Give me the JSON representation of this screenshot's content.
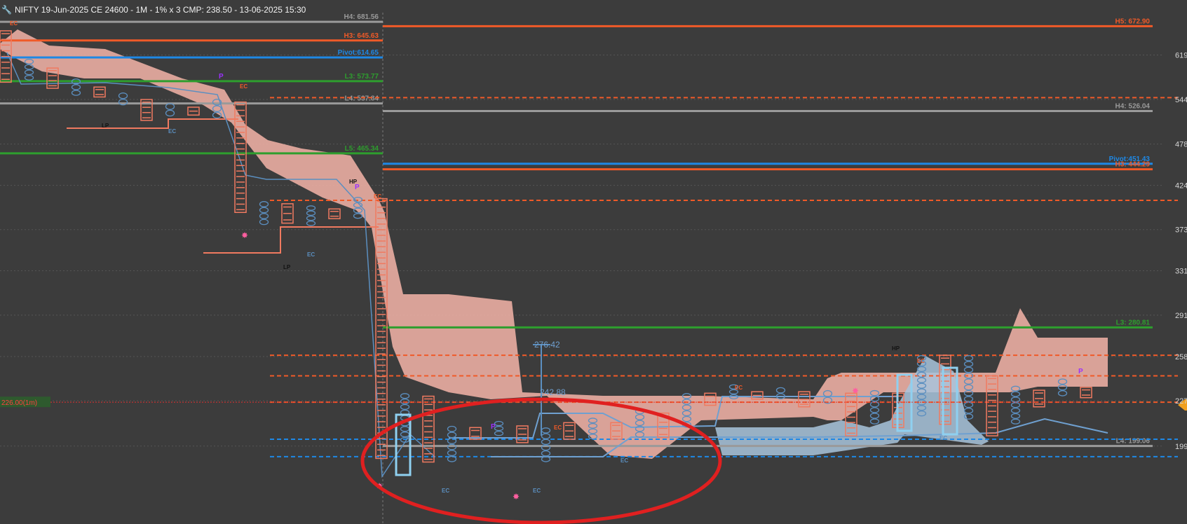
{
  "header": {
    "title": "NIFTY 19-Jun-2025 CE 24600 - 1M - 1% x 3 CMP: 238.50 - 13-06-2025 15:30"
  },
  "colors": {
    "background": "#3c3c3c",
    "resistance": "#f05a28",
    "pivot": "#1e88e5",
    "support": "#2e9e2e",
    "neutral": "#9a9a9a",
    "x_column": "#f07a60",
    "o_column": "#5b8fc0",
    "cloud_bear": "#f4b4a8",
    "cloud_bull": "#a8c4dc",
    "highlight_ellipse": "#e02020",
    "price_tag": "#f0a020"
  },
  "chart_data": {
    "type": "point-and-figure",
    "title": "NIFTY 19-Jun-2025 CE 24600 - 1M - 1% x 3 CMP: 238.50 - 13-06-2025 15:30",
    "ylim": [
      175,
      700
    ],
    "y_axis_scale": "log",
    "y_ticks": [
      "619",
      "544",
      "478",
      "424",
      "373",
      "331",
      "291",
      "258",
      "227",
      "199"
    ],
    "levels_left": [
      {
        "label": "H4: 681.56",
        "value": 681.56,
        "role": "neutral"
      },
      {
        "label": "H3: 645.63",
        "value": 645.63,
        "role": "resistance"
      },
      {
        "label": "Pivot:614.65",
        "value": 614.65,
        "role": "pivot"
      },
      {
        "label": "L3: 573.77",
        "value": 573.77,
        "role": "support"
      },
      {
        "label": "L4: 537.84",
        "value": 537.84,
        "role": "neutral"
      },
      {
        "label": "L5: 465.34",
        "value": 465.34,
        "role": "support"
      }
    ],
    "levels_right": [
      {
        "label": "H5: 672.90",
        "value": 672.9,
        "role": "resistance"
      },
      {
        "label": "H4: 526.04",
        "value": 526.04,
        "role": "neutral"
      },
      {
        "label": "Pivot:451.43",
        "value": 451.43,
        "role": "pivot"
      },
      {
        "label": "H3: 444.29",
        "value": 444.29,
        "role": "resistance"
      },
      {
        "label": "L3: 280.81",
        "value": 280.81,
        "role": "support"
      },
      {
        "label": "L4: 199.06",
        "value": 199.06,
        "role": "neutral"
      }
    ],
    "dashed_levels": [
      {
        "value": 547,
        "role": "resistance"
      },
      {
        "value": 406,
        "role": "resistance"
      },
      {
        "value": 259,
        "role": "resistance"
      },
      {
        "value": 244,
        "role": "resistance"
      },
      {
        "value": 226,
        "role": "resistance"
      },
      {
        "value": 203,
        "role": "pivot"
      },
      {
        "value": 193,
        "role": "pivot"
      }
    ],
    "marker_label": "226.00(1m)",
    "price_labels": [
      "276.42",
      "242.88"
    ],
    "annotations": [
      "EC",
      "LP",
      "HP",
      "P"
    ],
    "columns": [
      {
        "t": "X",
        "low": 572,
        "high": 664
      },
      {
        "t": "O",
        "low": 575,
        "high": 612
      },
      {
        "t": "X",
        "low": 562,
        "high": 596
      },
      {
        "t": "O",
        "low": 550,
        "high": 578
      },
      {
        "t": "X",
        "low": 548,
        "high": 564
      },
      {
        "t": "O",
        "low": 535,
        "high": 555
      },
      {
        "t": "X",
        "low": 512,
        "high": 544
      },
      {
        "t": "O",
        "low": 518,
        "high": 538
      },
      {
        "t": "X",
        "low": 520,
        "high": 532
      },
      {
        "t": "O",
        "low": 515,
        "high": 545
      },
      {
        "t": "X",
        "low": 392,
        "high": 540
      },
      {
        "t": "O",
        "low": 378,
        "high": 405
      },
      {
        "t": "X",
        "low": 380,
        "high": 402
      },
      {
        "t": "O",
        "low": 377,
        "high": 400
      },
      {
        "t": "X",
        "low": 385,
        "high": 396
      },
      {
        "t": "O",
        "low": 385,
        "high": 410
      },
      {
        "t": "X",
        "low": 192,
        "high": 408
      },
      {
        "t": "O",
        "low": 201,
        "high": 232
      },
      {
        "t": "X",
        "low": 190,
        "high": 230
      },
      {
        "t": "O",
        "low": 190,
        "high": 211
      },
      {
        "t": "X",
        "low": 203,
        "high": 210
      },
      {
        "t": "O",
        "low": 205,
        "high": 214
      },
      {
        "t": "X",
        "low": 201,
        "high": 211
      },
      {
        "t": "O",
        "low": 190,
        "high": 210
      },
      {
        "t": "X",
        "low": 203,
        "high": 213
      },
      {
        "t": "O",
        "low": 203,
        "high": 216
      },
      {
        "t": "X",
        "low": 203,
        "high": 213
      },
      {
        "t": "O",
        "low": 204,
        "high": 222
      },
      {
        "t": "X",
        "low": 204,
        "high": 219
      },
      {
        "t": "O",
        "low": 210,
        "high": 232
      },
      {
        "t": "X",
        "low": 224,
        "high": 232
      },
      {
        "t": "O",
        "low": 228,
        "high": 238
      },
      {
        "t": "X",
        "low": 228,
        "high": 233
      },
      {
        "t": "O",
        "low": 228,
        "high": 236
      },
      {
        "t": "X",
        "low": 223,
        "high": 233
      },
      {
        "t": "O",
        "low": 225,
        "high": 234
      },
      {
        "t": "X",
        "low": 205,
        "high": 232
      },
      {
        "t": "O",
        "low": 212,
        "high": 234
      },
      {
        "t": "X",
        "low": 210,
        "high": 232
      },
      {
        "t": "O",
        "low": 217,
        "high": 259
      },
      {
        "t": "X",
        "low": 212,
        "high": 259
      },
      {
        "t": "O",
        "low": 215,
        "high": 259
      },
      {
        "t": "X",
        "low": 205,
        "high": 244
      },
      {
        "t": "O",
        "low": 212,
        "high": 237
      },
      {
        "t": "X",
        "low": 223,
        "high": 234
      },
      {
        "t": "O",
        "low": 230,
        "high": 242
      },
      {
        "t": "X",
        "low": 229,
        "high": 236
      }
    ]
  }
}
